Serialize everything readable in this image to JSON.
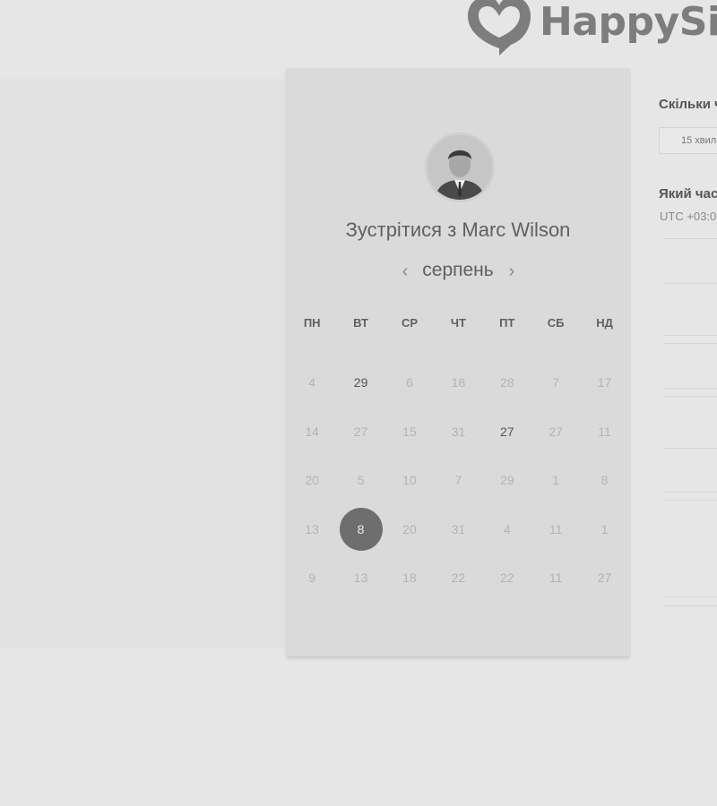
{
  "brand": {
    "name": "HappySig"
  },
  "meeting": {
    "title": "Зустрітися з Marc Wilson",
    "month": "серпень",
    "prev_icon": "chevron-left-icon",
    "next_icon": "chevron-right-icon"
  },
  "calendar": {
    "weekdays": [
      "ПН",
      "ВТ",
      "СР",
      "ЧТ",
      "ПТ",
      "СБ",
      "НД"
    ],
    "weeks": [
      [
        {
          "d": "4"
        },
        {
          "d": "29",
          "avail": true
        },
        {
          "d": "6"
        },
        {
          "d": "18"
        },
        {
          "d": "28"
        },
        {
          "d": "7"
        },
        {
          "d": "17"
        }
      ],
      [
        {
          "d": "14"
        },
        {
          "d": "27"
        },
        {
          "d": "15"
        },
        {
          "d": "31"
        },
        {
          "d": "27",
          "avail": true
        },
        {
          "d": "27"
        },
        {
          "d": "11"
        }
      ],
      [
        {
          "d": "20"
        },
        {
          "d": "5"
        },
        {
          "d": "10"
        },
        {
          "d": "7"
        },
        {
          "d": "29"
        },
        {
          "d": "1"
        },
        {
          "d": "8"
        }
      ],
      [
        {
          "d": "13"
        },
        {
          "d": "8",
          "selected": true
        },
        {
          "d": "20"
        },
        {
          "d": "31"
        },
        {
          "d": "4"
        },
        {
          "d": "11"
        },
        {
          "d": "1"
        }
      ],
      [
        {
          "d": "9"
        },
        {
          "d": "13"
        },
        {
          "d": "18"
        },
        {
          "d": "22"
        },
        {
          "d": "22"
        },
        {
          "d": "11"
        },
        {
          "d": "27"
        }
      ]
    ]
  },
  "sidebar": {
    "duration_label": "Скільки ч",
    "duration_value": "15 хвил",
    "time_label": "Який час",
    "timezone": "UTC +03:0"
  }
}
